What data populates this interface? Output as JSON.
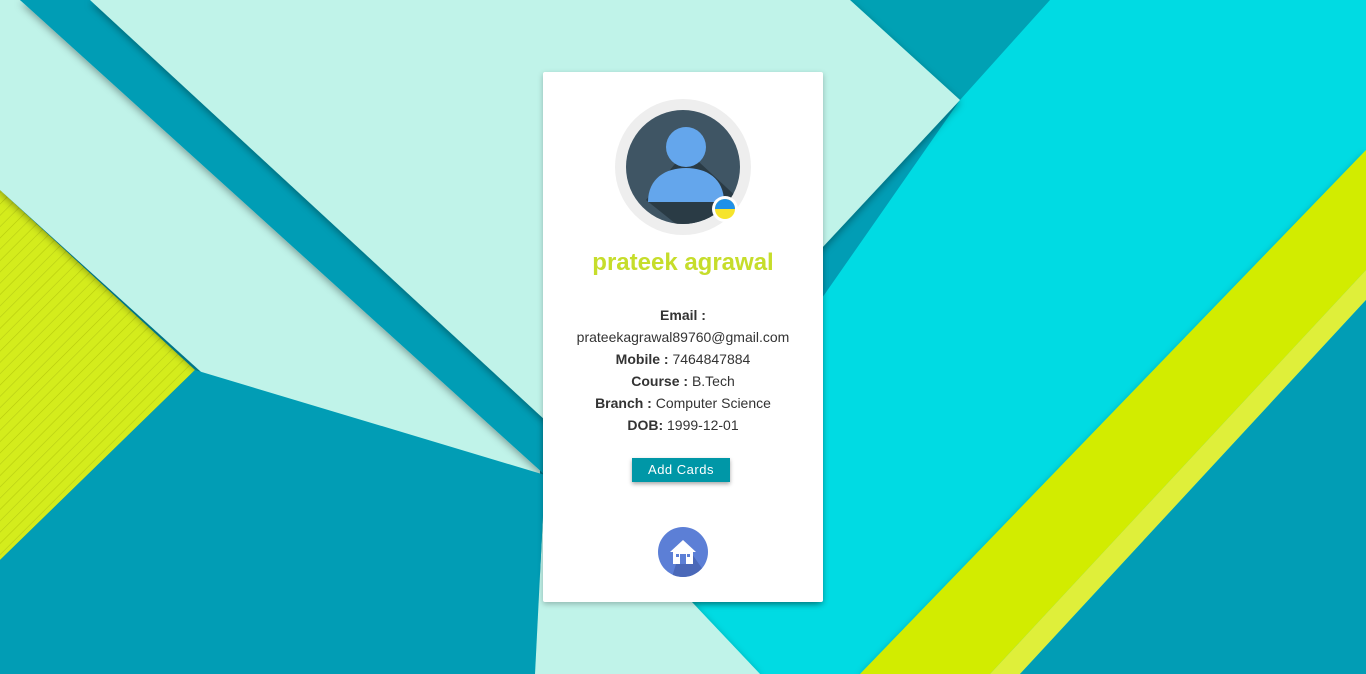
{
  "profile": {
    "name": "prateek agrawal",
    "email_label": "Email :",
    "email": "prateekagrawal89760@gmail.com",
    "mobile_label": "Mobile :",
    "mobile": "7464847884",
    "course_label": "Course :",
    "course": "B.Tech",
    "branch_label": "Branch :",
    "branch": "Computer Science",
    "dob_label": "DOB:",
    "dob": "1999-12-01"
  },
  "actions": {
    "add_cards_label": "Add Cards"
  },
  "icons": {
    "avatar": "user-avatar-icon",
    "status": "status-dot-icon",
    "home": "home-icon"
  },
  "colors": {
    "name_accent": "#c6dd2b",
    "button": "#0097a7",
    "home_button": "#5c7fd6"
  }
}
